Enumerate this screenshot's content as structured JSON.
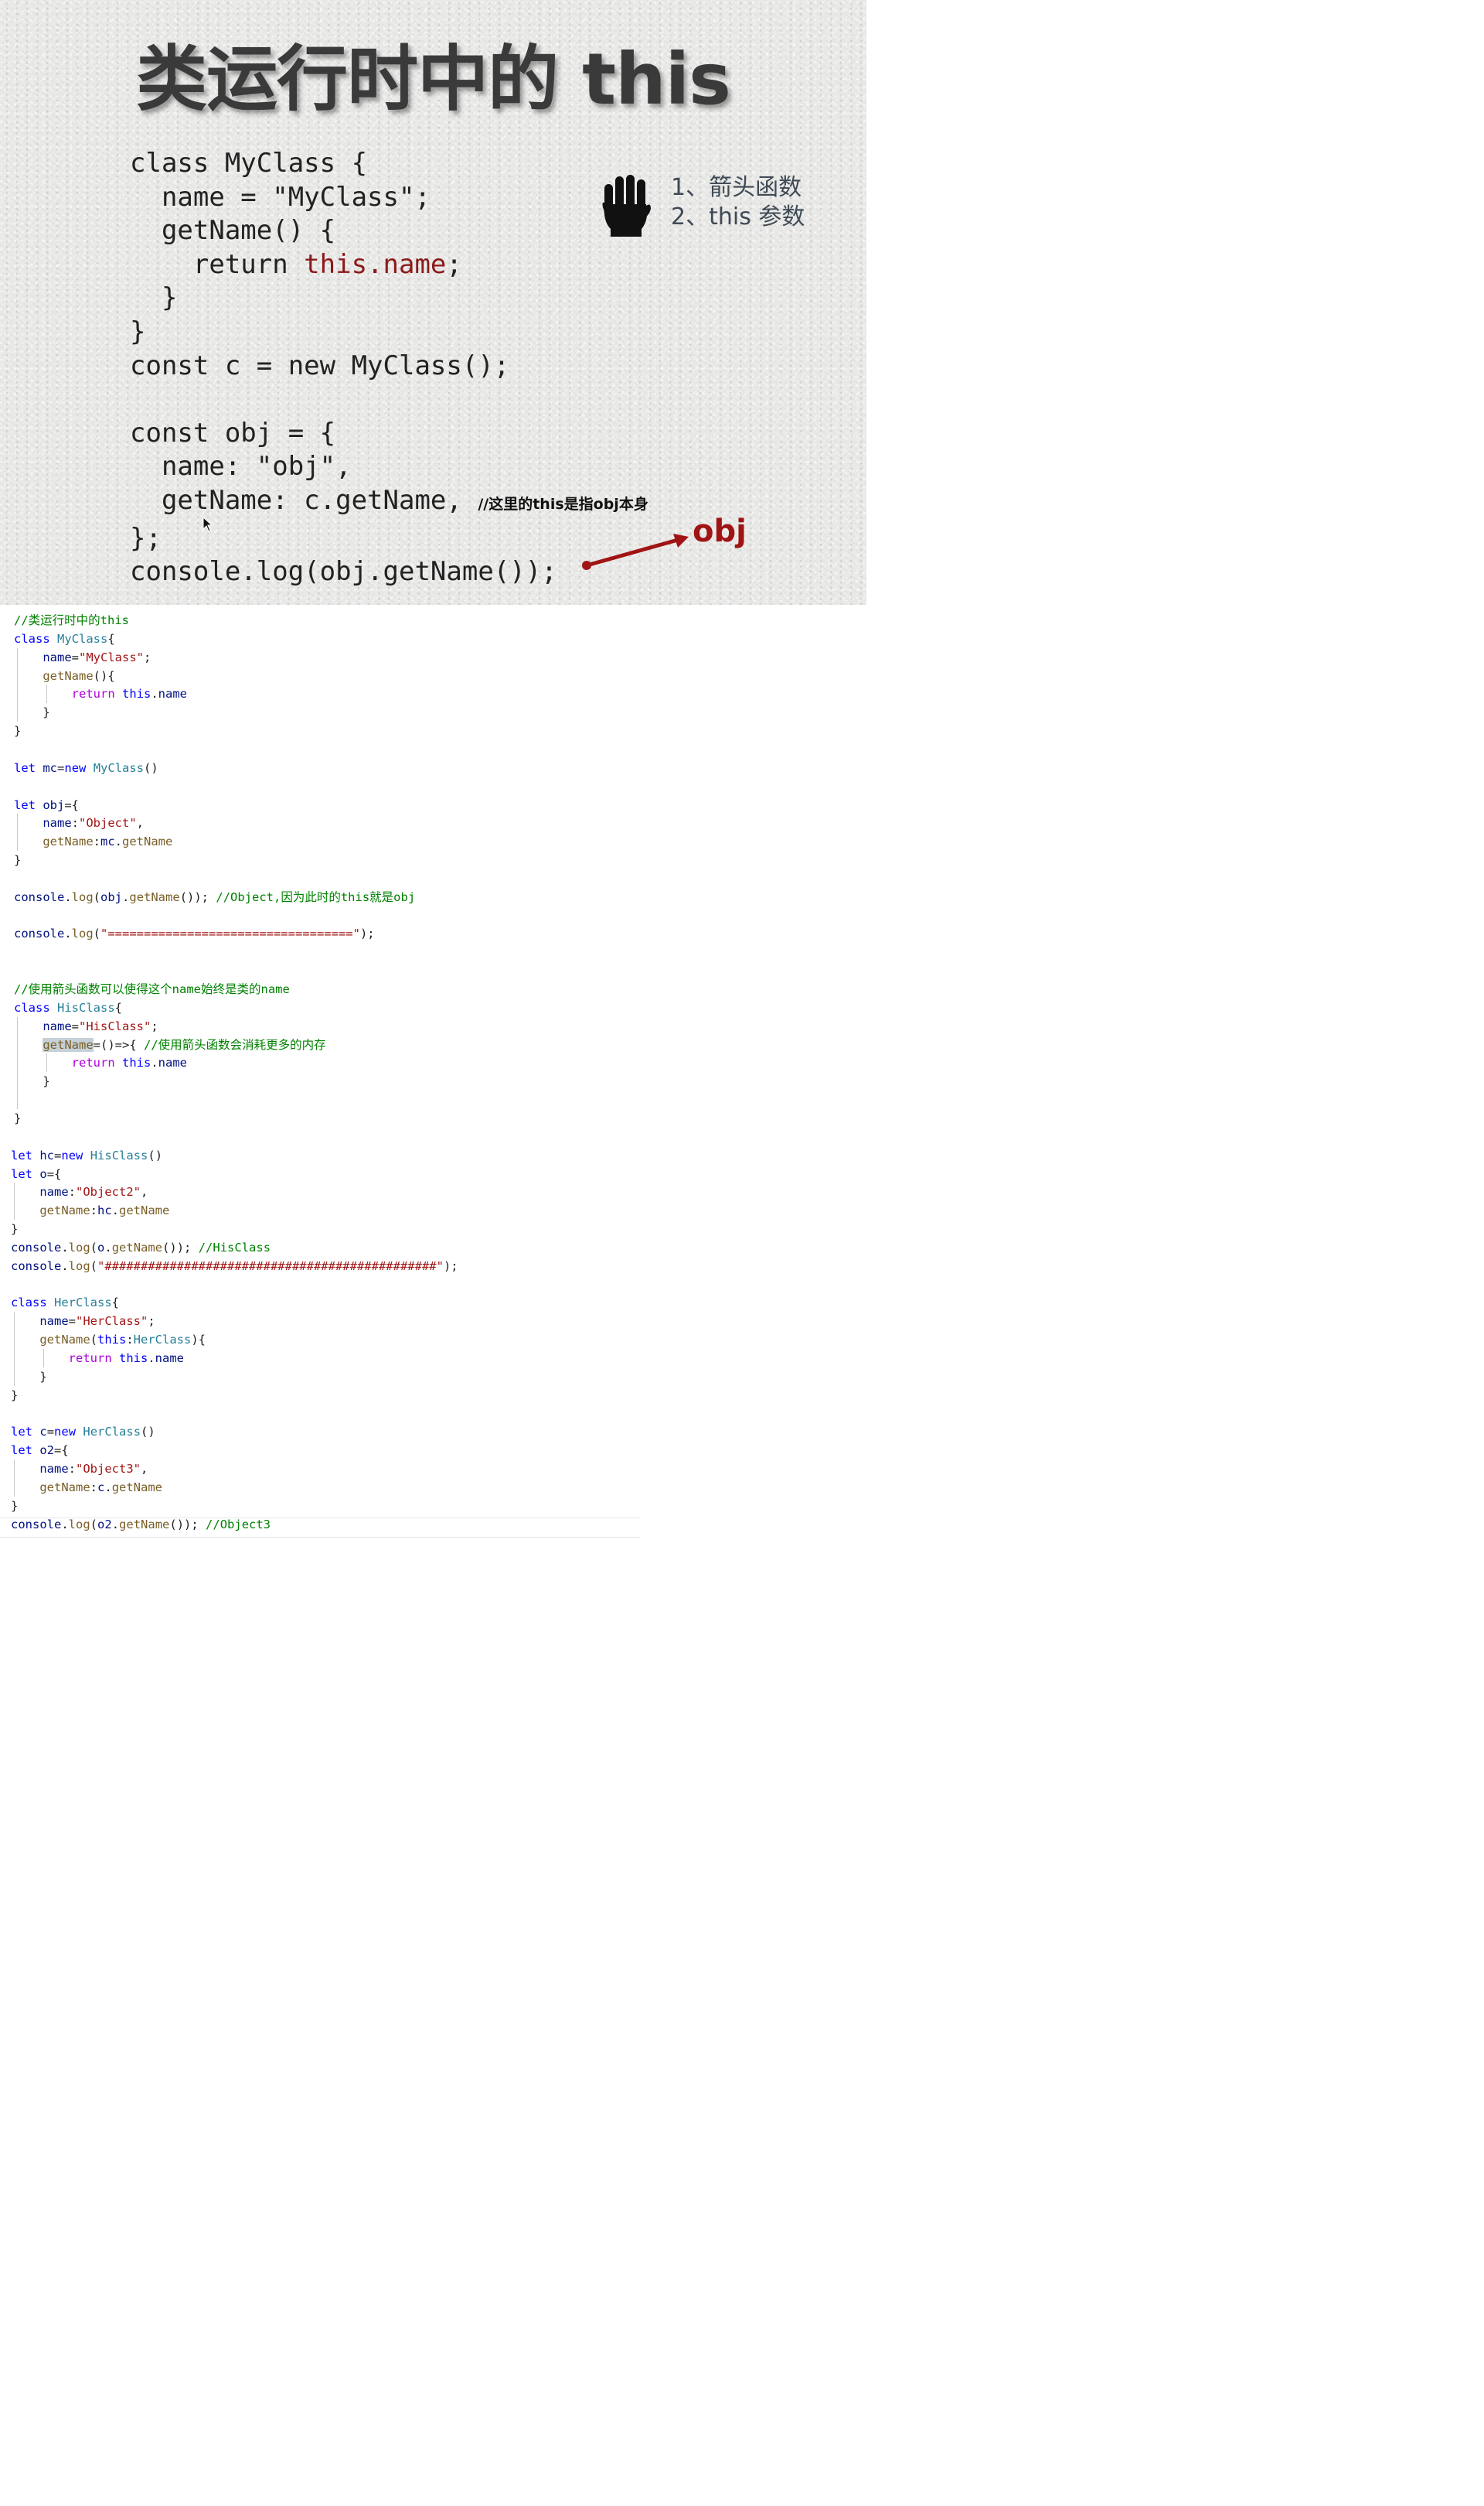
{
  "slide": {
    "title": "类运行时中的 this",
    "code_lines": [
      "class MyClass {",
      "  name = \"MyClass\";",
      "  getName() {",
      "    return ",
      "this.name",
      ";",
      "  }",
      "}",
      "const c = new MyClass();",
      "",
      "const obj = {",
      "  name: \"obj\",",
      "  getName: c.getName, ",
      "//这里的this是指obj本身",
      "};",
      "console.log(obj.getName());"
    ],
    "tips": [
      "1、箭头函数",
      "2、this 参数"
    ],
    "arrow_label": "obj",
    "colors": {
      "highlight": "#8b1a1a",
      "arrow": "#a01414",
      "title": "#3a3a3a"
    },
    "icons": [
      "hand-stop-icon",
      "red-arrow-icon",
      "mouse-cursor-icon"
    ]
  },
  "editor": {
    "colors": {
      "keyword": "#0000ff",
      "control": "#af00db",
      "type": "#267f99",
      "string": "#a31515",
      "comment": "#008000",
      "variable": "#001080",
      "function": "#795e26"
    },
    "lines": [
      [
        [
          "c",
          "//类运行时中的this"
        ]
      ],
      [
        [
          "k",
          "class"
        ],
        [
          "p",
          " "
        ],
        [
          "t",
          "MyClass"
        ],
        [
          "p",
          "{"
        ]
      ],
      [
        [
          "p",
          "    "
        ],
        [
          "v",
          "name"
        ],
        [
          "p",
          "="
        ],
        [
          "s",
          "\"MyClass\""
        ],
        [
          "p",
          ";"
        ]
      ],
      [
        [
          "p",
          "    "
        ],
        [
          "f",
          "getName"
        ],
        [
          "p",
          "(){"
        ]
      ],
      [
        [
          "p",
          "        "
        ],
        [
          "ctl",
          "return"
        ],
        [
          "p",
          " "
        ],
        [
          "k",
          "this"
        ],
        [
          "p",
          "."
        ],
        [
          "v",
          "name"
        ]
      ],
      [
        [
          "p",
          "    }"
        ]
      ],
      [
        [
          "p",
          "}"
        ]
      ],
      [],
      [
        [
          "k",
          "let"
        ],
        [
          "p",
          " "
        ],
        [
          "v",
          "mc"
        ],
        [
          "p",
          "="
        ],
        [
          "k",
          "new"
        ],
        [
          "p",
          " "
        ],
        [
          "t",
          "MyClass"
        ],
        [
          "p",
          "()"
        ]
      ],
      [],
      [
        [
          "k",
          "let"
        ],
        [
          "p",
          " "
        ],
        [
          "v",
          "obj"
        ],
        [
          "p",
          "={"
        ]
      ],
      [
        [
          "p",
          "    "
        ],
        [
          "v",
          "name"
        ],
        [
          "p",
          ":"
        ],
        [
          "s",
          "\"Object\""
        ],
        [
          "p",
          ","
        ]
      ],
      [
        [
          "p",
          "    "
        ],
        [
          "f",
          "getName"
        ],
        [
          "p",
          ":"
        ],
        [
          "v",
          "mc"
        ],
        [
          "p",
          "."
        ],
        [
          "f",
          "getName"
        ]
      ],
      [
        [
          "p",
          "}"
        ]
      ],
      [],
      [
        [
          "v",
          "console"
        ],
        [
          "p",
          "."
        ],
        [
          "f",
          "log"
        ],
        [
          "p",
          "("
        ],
        [
          "v",
          "obj"
        ],
        [
          "p",
          "."
        ],
        [
          "f",
          "getName"
        ],
        [
          "p",
          "()); "
        ],
        [
          "c",
          "//Object,因为此时的this就是obj"
        ]
      ],
      [],
      [
        [
          "v",
          "console"
        ],
        [
          "p",
          "."
        ],
        [
          "f",
          "log"
        ],
        [
          "p",
          "("
        ],
        [
          "s",
          "\"==================================\""
        ],
        [
          "p",
          ");"
        ]
      ],
      [],
      [],
      [
        [
          "c",
          "//使用箭头函数可以使得这个name始终是类的name"
        ]
      ],
      [
        [
          "k",
          "class"
        ],
        [
          "p",
          " "
        ],
        [
          "t",
          "HisClass"
        ],
        [
          "p",
          "{"
        ]
      ],
      [
        [
          "p",
          "    "
        ],
        [
          "v",
          "name"
        ],
        [
          "p",
          "="
        ],
        [
          "s",
          "\"HisClass\""
        ],
        [
          "p",
          ";"
        ]
      ],
      [
        [
          "p",
          "    "
        ],
        [
          "fsel",
          "getName"
        ],
        [
          "p",
          "=()=>{ "
        ],
        [
          "c",
          "//使用箭头函数会消耗更多的内存"
        ]
      ],
      [
        [
          "p",
          "        "
        ],
        [
          "ctl",
          "return"
        ],
        [
          "p",
          " "
        ],
        [
          "k",
          "this"
        ],
        [
          "p",
          "."
        ],
        [
          "v",
          "name"
        ]
      ],
      [
        [
          "p",
          "    }"
        ]
      ],
      [],
      [
        [
          "p",
          "}"
        ]
      ],
      [],
      [
        [
          "k",
          "let"
        ],
        [
          "p",
          " "
        ],
        [
          "v",
          "hc"
        ],
        [
          "p",
          "="
        ],
        [
          "k",
          "new"
        ],
        [
          "p",
          " "
        ],
        [
          "t",
          "HisClass"
        ],
        [
          "p",
          "()"
        ]
      ],
      [
        [
          "k",
          "let"
        ],
        [
          "p",
          " "
        ],
        [
          "v",
          "o"
        ],
        [
          "p",
          "={"
        ]
      ],
      [
        [
          "p",
          "    "
        ],
        [
          "v",
          "name"
        ],
        [
          "p",
          ":"
        ],
        [
          "s",
          "\"Object2\""
        ],
        [
          "p",
          ","
        ]
      ],
      [
        [
          "p",
          "    "
        ],
        [
          "f",
          "getName"
        ],
        [
          "p",
          ":"
        ],
        [
          "v",
          "hc"
        ],
        [
          "p",
          "."
        ],
        [
          "f",
          "getName"
        ]
      ],
      [
        [
          "p",
          "}"
        ]
      ],
      [
        [
          "v",
          "console"
        ],
        [
          "p",
          "."
        ],
        [
          "f",
          "log"
        ],
        [
          "p",
          "("
        ],
        [
          "v",
          "o"
        ],
        [
          "p",
          "."
        ],
        [
          "f",
          "getName"
        ],
        [
          "p",
          "()); "
        ],
        [
          "c",
          "//HisClass"
        ]
      ],
      [
        [
          "v",
          "console"
        ],
        [
          "p",
          "."
        ],
        [
          "f",
          "log"
        ],
        [
          "p",
          "("
        ],
        [
          "s",
          "\"##############################################\""
        ],
        [
          "p",
          ");"
        ]
      ],
      [],
      [
        [
          "k",
          "class"
        ],
        [
          "p",
          " "
        ],
        [
          "t",
          "HerClass"
        ],
        [
          "p",
          "{"
        ]
      ],
      [
        [
          "p",
          "    "
        ],
        [
          "v",
          "name"
        ],
        [
          "p",
          "="
        ],
        [
          "s",
          "\"HerClass\""
        ],
        [
          "p",
          ";"
        ]
      ],
      [
        [
          "p",
          "    "
        ],
        [
          "f",
          "getName"
        ],
        [
          "p",
          "("
        ],
        [
          "k",
          "this"
        ],
        [
          "p",
          ":"
        ],
        [
          "t",
          "HerClass"
        ],
        [
          "p",
          "){"
        ]
      ],
      [
        [
          "p",
          "        "
        ],
        [
          "ctl",
          "return"
        ],
        [
          "p",
          " "
        ],
        [
          "k",
          "this"
        ],
        [
          "p",
          "."
        ],
        [
          "v",
          "name"
        ]
      ],
      [
        [
          "p",
          "    }"
        ]
      ],
      [
        [
          "p",
          "}"
        ]
      ],
      [],
      [
        [
          "k",
          "let"
        ],
        [
          "p",
          " "
        ],
        [
          "v",
          "c"
        ],
        [
          "p",
          "="
        ],
        [
          "k",
          "new"
        ],
        [
          "p",
          " "
        ],
        [
          "t",
          "HerClass"
        ],
        [
          "p",
          "()"
        ]
      ],
      [
        [
          "k",
          "let"
        ],
        [
          "p",
          " "
        ],
        [
          "v",
          "o2"
        ],
        [
          "p",
          "={"
        ]
      ],
      [
        [
          "p",
          "    "
        ],
        [
          "v",
          "name"
        ],
        [
          "p",
          ":"
        ],
        [
          "s",
          "\"Object3\""
        ],
        [
          "p",
          ","
        ]
      ],
      [
        [
          "p",
          "    "
        ],
        [
          "f",
          "getName"
        ],
        [
          "p",
          ":"
        ],
        [
          "v",
          "c"
        ],
        [
          "p",
          "."
        ],
        [
          "f",
          "getName"
        ]
      ],
      [
        [
          "p",
          "}"
        ]
      ],
      [
        [
          "v",
          "console"
        ],
        [
          "p",
          "."
        ],
        [
          "f",
          "log"
        ],
        [
          "p",
          "("
        ],
        [
          "v",
          "o2"
        ],
        [
          "p",
          "."
        ],
        [
          "f",
          "getName"
        ],
        [
          "p",
          "()); "
        ],
        [
          "c",
          "//Object3"
        ]
      ]
    ]
  }
}
